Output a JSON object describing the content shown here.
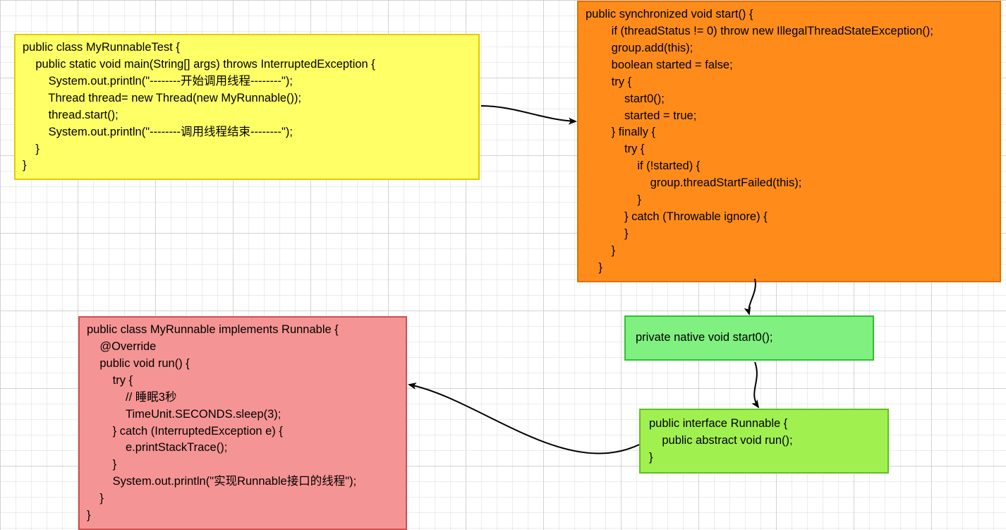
{
  "diagram": {
    "nodes": {
      "myRunnableTest": {
        "code": "public class MyRunnableTest {\n    public static void main(String[] args) throws InterruptedException {\n        System.out.println(\"--------开始调用线程--------\");\n        Thread thread= new Thread(new MyRunnable());\n        thread.start();\n        System.out.println(\"--------调用线程结束--------\");\n    }\n}"
      },
      "startMethod": {
        "code": "public synchronized void start() {\n        if (threadStatus != 0) throw new IllegalThreadStateException();\n        group.add(this);\n        boolean started = false;\n        try {\n            start0();\n            started = true;\n        } finally {\n            try {\n                if (!started) {\n                    group.threadStartFailed(this);\n                }\n            } catch (Throwable ignore) {\n            }\n        }\n    }"
      },
      "myRunnable": {
        "code": "public class MyRunnable implements Runnable {\n    @Override\n    public void run() {\n        try {\n            // 睡眠3秒\n            TimeUnit.SECONDS.sleep(3);\n        } catch (InterruptedException e) {\n            e.printStackTrace();\n        }\n        System.out.println(\"实现Runnable接口的线程\");\n    }\n}"
      },
      "start0": {
        "code": "private native void start0();"
      },
      "runnable": {
        "code": "public interface Runnable {\n    public abstract void run();\n}"
      }
    },
    "colors": {
      "yellow": "#FFFF66",
      "orange": "#FF8C1A",
      "pink": "#F59494",
      "green1": "#80F080",
      "green2": "#A0F050"
    }
  }
}
